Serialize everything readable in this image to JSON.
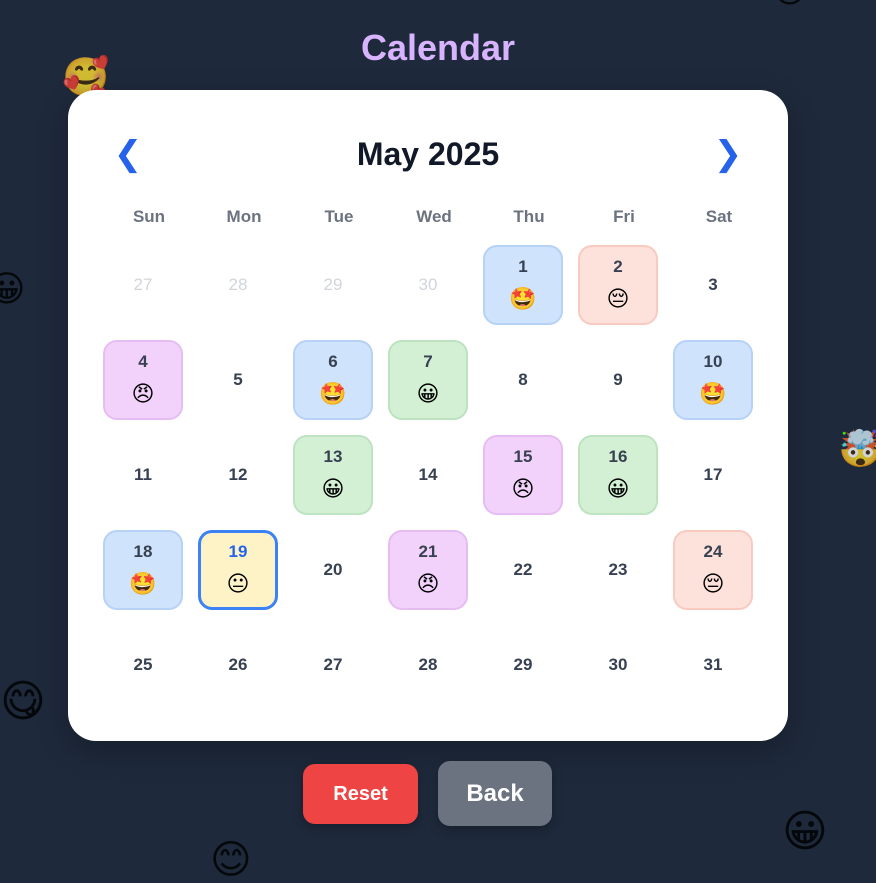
{
  "title": "Calendar",
  "month_label": "May 2025",
  "nav": {
    "prev_icon": "chevron-left-icon",
    "prev_glyph": "❮",
    "next_icon": "chevron-right-icon",
    "next_glyph": "❯"
  },
  "weekdays": [
    "Sun",
    "Mon",
    "Tue",
    "Wed",
    "Thu",
    "Fri",
    "Sat"
  ],
  "mood_emojis": {
    "excited": "🤩",
    "sad": "😔",
    "angry": "😠",
    "happy": "😀",
    "neutral": "😐"
  },
  "weeks": [
    [
      {
        "day": "27",
        "other": true
      },
      {
        "day": "28",
        "other": true
      },
      {
        "day": "29",
        "other": true
      },
      {
        "day": "30",
        "other": true
      },
      {
        "day": "1",
        "mood": "excited"
      },
      {
        "day": "2",
        "mood": "sad"
      },
      {
        "day": "3"
      }
    ],
    [
      {
        "day": "4",
        "mood": "angry"
      },
      {
        "day": "5"
      },
      {
        "day": "6",
        "mood": "excited"
      },
      {
        "day": "7",
        "mood": "happy"
      },
      {
        "day": "8"
      },
      {
        "day": "9"
      },
      {
        "day": "10",
        "mood": "excited"
      }
    ],
    [
      {
        "day": "11"
      },
      {
        "day": "12"
      },
      {
        "day": "13",
        "mood": "happy"
      },
      {
        "day": "14"
      },
      {
        "day": "15",
        "mood": "angry"
      },
      {
        "day": "16",
        "mood": "happy"
      },
      {
        "day": "17"
      }
    ],
    [
      {
        "day": "18",
        "mood": "excited"
      },
      {
        "day": "19",
        "mood": "neutral",
        "today": true
      },
      {
        "day": "20"
      },
      {
        "day": "21",
        "mood": "angry"
      },
      {
        "day": "22"
      },
      {
        "day": "23"
      },
      {
        "day": "24",
        "mood": "sad"
      }
    ],
    [
      {
        "day": "25"
      },
      {
        "day": "26"
      },
      {
        "day": "27"
      },
      {
        "day": "28"
      },
      {
        "day": "29"
      },
      {
        "day": "30"
      },
      {
        "day": "31"
      }
    ]
  ],
  "buttons": {
    "reset": "Reset",
    "back": "Back"
  },
  "background_emojis": [
    "🥰",
    "😀",
    "🤯",
    "😋",
    "😊",
    "😀",
    "😊"
  ],
  "colors": {
    "background": "#1e293b",
    "title": "#d8b4fe",
    "accent": "#2563eb",
    "reset": "#ef4444",
    "back": "#6b7280",
    "today_bg": "#fef3c7"
  }
}
